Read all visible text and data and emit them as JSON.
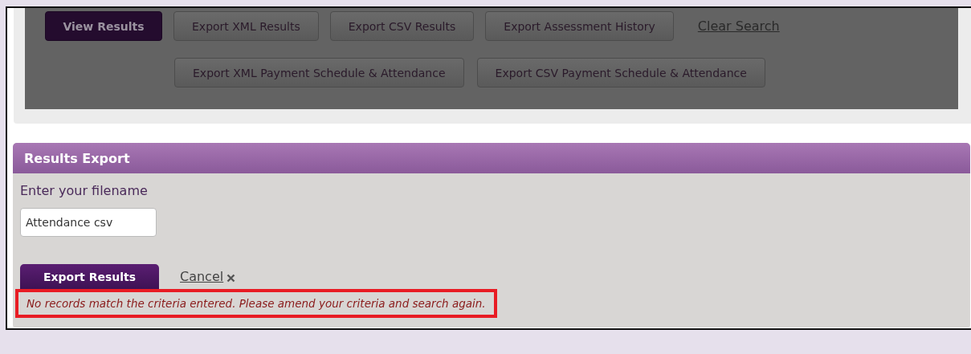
{
  "search_actions": {
    "main_buttons": [
      {
        "label": "View Results",
        "kind": "primary"
      },
      {
        "label": "Export XML Results",
        "kind": "secondary"
      },
      {
        "label": "Export CSV Results",
        "kind": "secondary"
      },
      {
        "label": "Export Assessment History",
        "kind": "secondary"
      },
      {
        "label": "Clear Search",
        "kind": "link"
      }
    ],
    "payment_buttons": [
      {
        "label": "Export XML Payment Schedule & Attendance",
        "kind": "secondary"
      },
      {
        "label": "Export CSV Payment Schedule & Attendance",
        "kind": "secondary"
      }
    ]
  },
  "export_panel": {
    "title": "Results Export",
    "filename_label": "Enter your filename",
    "filename_value": "Attendance csv",
    "export_button": "Export Results",
    "cancel_link": "Cancel",
    "error": "No records match the criteria entered. Please amend your criteria and search again."
  }
}
